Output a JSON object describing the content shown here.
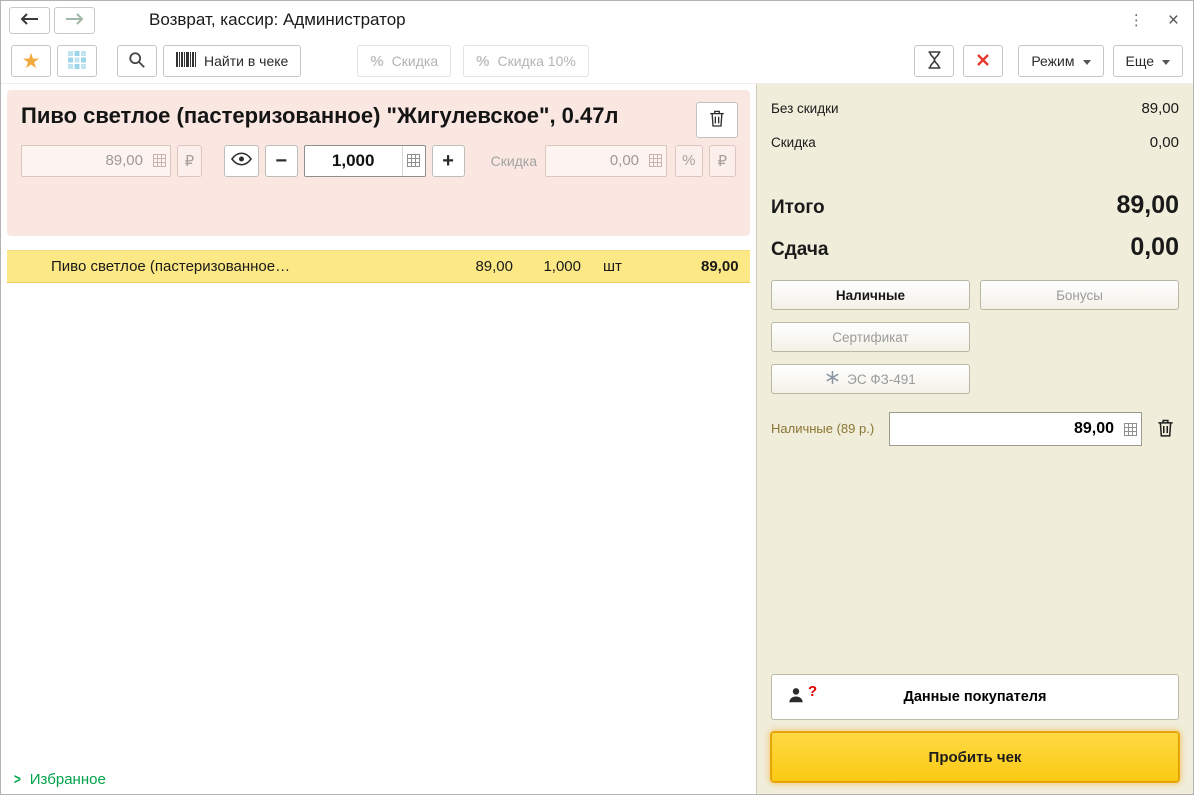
{
  "titlebar": {
    "title": "Возврат, кассир: Администратор"
  },
  "icons": {
    "kebab": "⋮",
    "close": "×",
    "star": "★",
    "percent": "%",
    "rub": "₽",
    "chevron": ">",
    "question": "?"
  },
  "toolbar": {
    "find_in_check": "Найти в чеке",
    "discount": "Скидка",
    "discount_10": "Скидка 10%",
    "mode": "Режим",
    "more": "Еще"
  },
  "product": {
    "name": "Пиво светлое (пастеризованное) \"Жигулевское\", 0.47л",
    "price": "89,00",
    "qty": "1,000",
    "minus": "−",
    "plus": "+",
    "discount_label": "Скидка",
    "discount_value": "0,00"
  },
  "receipt": {
    "rows": [
      {
        "name": "Пиво светлое (пастеризованное…",
        "price": "89,00",
        "qty": "1,000",
        "unit": "шт",
        "sum": "89,00"
      }
    ]
  },
  "favorites": {
    "label": "Избранное"
  },
  "totals": {
    "no_discount_label": "Без скидки",
    "no_discount": "89,00",
    "discount_label": "Скидка",
    "discount": "0,00",
    "total_label": "Итого",
    "total": "89,00",
    "change_label": "Сдача",
    "change": "0,00"
  },
  "payments": {
    "cash": "Наличные",
    "bonus": "Бонусы",
    "certificate": "Сертификат",
    "es": "ЭС ФЗ-491",
    "cash_field_label": "Наличные (89 р.)",
    "cash_amount": "89,00"
  },
  "actions": {
    "customer_data": "Данные покупателя",
    "submit": "Пробить чек"
  }
}
